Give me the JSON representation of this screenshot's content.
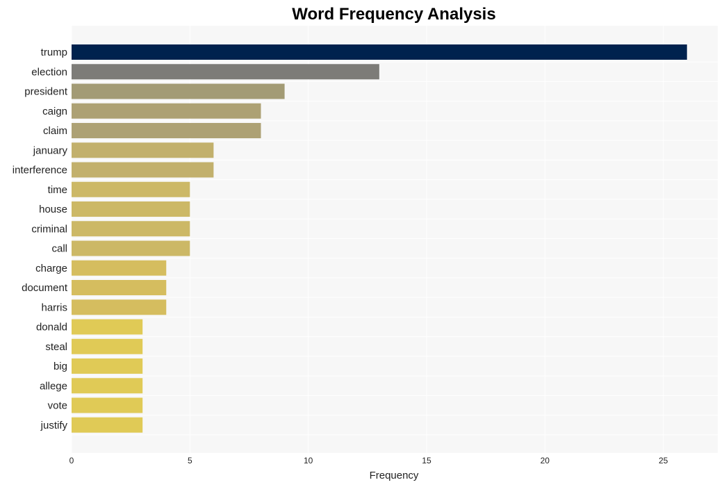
{
  "chart_data": {
    "type": "bar",
    "orientation": "horizontal",
    "title": "Word Frequency Analysis",
    "xlabel": "Frequency",
    "ylabel": "",
    "xlim": [
      0,
      27.3
    ],
    "xticks": [
      0,
      5,
      10,
      15,
      20,
      25
    ],
    "grid": true,
    "categories": [
      "trump",
      "election",
      "president",
      "caign",
      "claim",
      "january",
      "interference",
      "time",
      "house",
      "criminal",
      "call",
      "charge",
      "document",
      "harris",
      "donald",
      "steal",
      "big",
      "allege",
      "vote",
      "justify"
    ],
    "values": [
      26,
      13,
      9,
      8,
      8,
      6,
      6,
      5,
      5,
      5,
      5,
      4,
      4,
      4,
      3,
      3,
      3,
      3,
      3,
      3
    ],
    "colors": [
      "#00224e",
      "#7d7c78",
      "#a39b75",
      "#ada174",
      "#ada174",
      "#c2b06c",
      "#c2b06c",
      "#ccb866",
      "#ccb866",
      "#ccb866",
      "#ccb866",
      "#d5bd5f",
      "#d5bd5f",
      "#d5bd5f",
      "#e0ca56",
      "#e0ca56",
      "#e0ca56",
      "#e0ca56",
      "#e0ca56",
      "#e0ca56"
    ],
    "background": "#f7f7f7"
  }
}
